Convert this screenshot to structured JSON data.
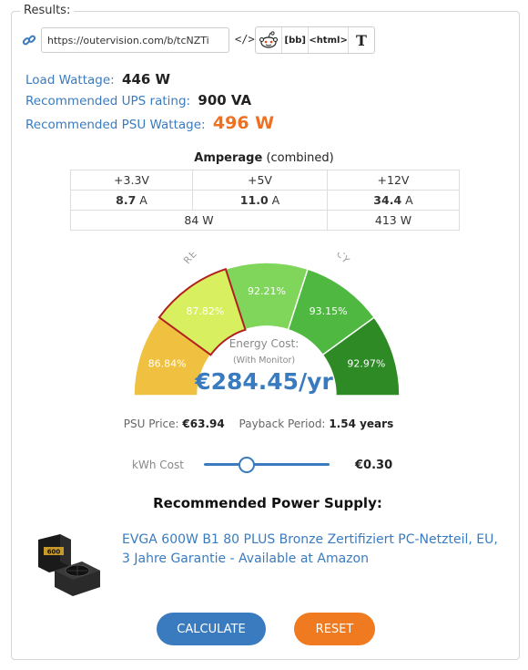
{
  "results_legend": "Results:",
  "share": {
    "url": "https://outervision.com/b/tcNZTi",
    "code_label": "</>",
    "buttons": [
      {
        "label": "reddit",
        "icon": "reddit-icon"
      },
      {
        "label": "[bb]"
      },
      {
        "label": "<html>"
      },
      {
        "label": "T"
      }
    ]
  },
  "load_wattage": {
    "label": "Load Wattage:",
    "value": "446 W"
  },
  "ups_rating": {
    "label": "Recommended UPS rating:",
    "value": "900 VA"
  },
  "psu_wattage": {
    "label": "Recommended PSU Wattage:",
    "value": "496 W"
  },
  "amperage": {
    "title_bold": "Amperage",
    "title_rest": "(combined)",
    "rails": [
      "+3.3V",
      "+5V",
      "+12V"
    ],
    "amps": [
      {
        "value": "8.7",
        "unit": "A"
      },
      {
        "value": "11.0",
        "unit": "A"
      },
      {
        "value": "34.4",
        "unit": "A"
      }
    ],
    "watts": [
      "84 W",
      "413 W"
    ]
  },
  "gauge": {
    "arc_title": "RECOMMENDED PSU EFFICIENCY",
    "segments": [
      "86.84%",
      "87.82%",
      "92.21%",
      "93.15%",
      "92.97%"
    ],
    "colors": [
      "#f0c040",
      "#d8ef60",
      "#7fd65a",
      "#4fb840",
      "#2e8a24"
    ],
    "energy_label": "Energy Cost:",
    "energy_sub": "(With Monitor)",
    "energy_value": "€284.45/yr"
  },
  "psu_price": {
    "label": "PSU Price:",
    "value": "€63.94"
  },
  "payback": {
    "label": "Payback Period:",
    "value": "1.54 years"
  },
  "kwh": {
    "label": "kWh Cost",
    "value": "€0.30"
  },
  "recommended_title": "Recommended Power Supply:",
  "product_link": "EVGA 600W B1 80 PLUS Bronze Zertifiziert PC-Netzteil, EU, 3 Jahre Garantie - Available at Amazon",
  "buttons": {
    "calculate": "CALCULATE",
    "reset": "RESET"
  }
}
